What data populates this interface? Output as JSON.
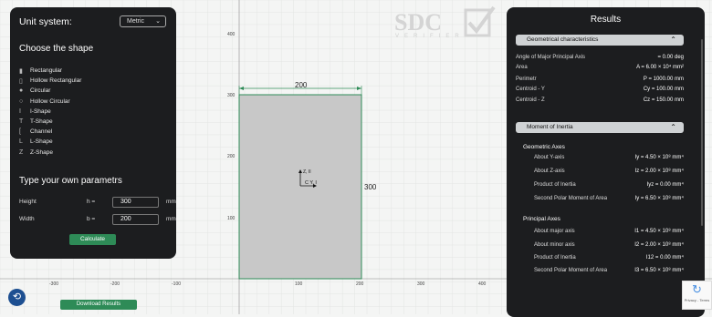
{
  "left_panel": {
    "unit_label": "Unit system:",
    "unit_value": "Metric",
    "choose_heading": "Choose the shape",
    "shapes": [
      {
        "label": "Rectangular",
        "icon": "filled-rect-icon"
      },
      {
        "label": "Hollow Rectangular",
        "icon": "hollow-rect-icon"
      },
      {
        "label": "Circular",
        "icon": "filled-circle-icon"
      },
      {
        "label": "Hollow Circular",
        "icon": "hollow-circle-icon"
      },
      {
        "label": "I-Shape",
        "icon": "i-shape-icon"
      },
      {
        "label": "T-Shape",
        "icon": "t-shape-icon"
      },
      {
        "label": "Channel",
        "icon": "channel-icon"
      },
      {
        "label": "L-Shape",
        "icon": "l-shape-icon"
      },
      {
        "label": "Z-Shape",
        "icon": "z-shape-icon"
      }
    ],
    "params_heading": "Type your own parametrs",
    "height_label": "Height",
    "height_var": "h =",
    "height_value": "300",
    "height_unit": "mm",
    "width_label": "Width",
    "width_var": "b =",
    "width_value": "200",
    "width_unit": "mm",
    "calculate": "Calculate"
  },
  "canvas": {
    "x_ticks": [
      "-300",
      "-200",
      "-100",
      "100",
      "200",
      "300",
      "400"
    ],
    "y_ticks": [
      "400",
      "300",
      "200",
      "100"
    ],
    "dim_width": "200",
    "dim_height": "300",
    "axis_z": "Z, II",
    "axis_y": "C Y, I",
    "rect_fill": "#c8c8c8",
    "rect_stroke": "#2e8b57",
    "watermark": "SDC",
    "watermark_sub": "VERIFIER"
  },
  "results": {
    "title": "Results",
    "geo_section": "Geometrical characteristics",
    "geo_rows": [
      {
        "label": "Angle of Major Principal Axis",
        "value": "= 0.00 deg"
      },
      {
        "label": "Area",
        "value": "A = 6.00 × 10⁴ mm²"
      },
      {
        "label": "Perimetr",
        "value": "P = 1000.00 mm"
      },
      {
        "label": "Centroid - Y",
        "value": "Cy = 100.00 mm"
      },
      {
        "label": "Centroid - Z",
        "value": "Cz = 150.00 mm"
      }
    ],
    "moi_section": "Moment of Inertia",
    "geo_axes_heading": "Geometric Axes",
    "geo_axes_rows": [
      {
        "label": "About Y-axis",
        "value": "Iy = 4.50 × 10⁸ mm⁴"
      },
      {
        "label": "About Z-axis",
        "value": "Iz = 2.00 × 10⁸ mm⁴"
      },
      {
        "label": "Product of Inertia",
        "value": "Iyz = 0.00 mm⁴"
      },
      {
        "label": "Second Polar Moment of Area",
        "value": "Iy = 6.50 × 10⁸ mm⁴"
      }
    ],
    "principal_heading": "Principal Axes",
    "principal_rows": [
      {
        "label": "About major axis",
        "value": "I1 = 4.50 × 10⁸ mm⁴"
      },
      {
        "label": "About minor axis",
        "value": "I2 = 2.00 × 10⁸ mm⁴"
      },
      {
        "label": "Product of Inertia",
        "value": "I12 = 0.00 mm⁴"
      },
      {
        "label": "Second Polar Moment of Area",
        "value": "I3 = 6.50 × 10⁸ mm⁴"
      }
    ],
    "download": "Download Results"
  },
  "captcha_text": "Privacy - Terms"
}
